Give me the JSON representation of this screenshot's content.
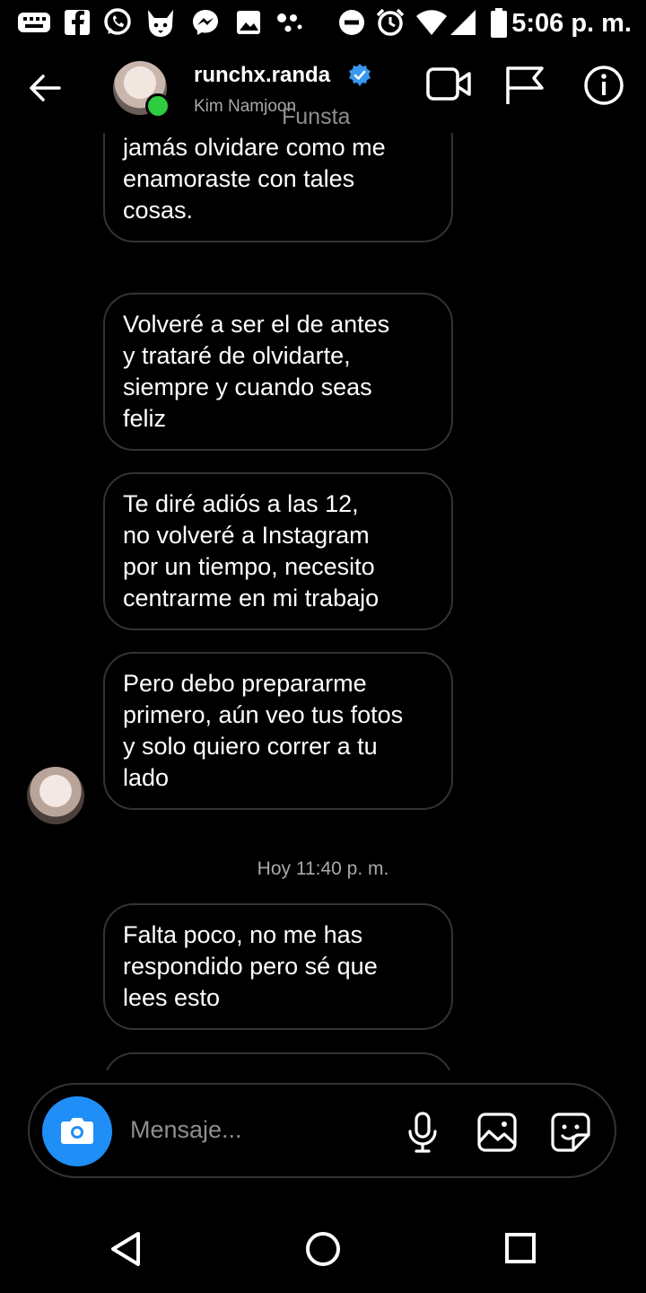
{
  "status_bar": {
    "time": "5:06 p. m.",
    "icons": [
      "keyboard-icon",
      "facebook-icon",
      "whatsapp-icon",
      "fox-icon",
      "messenger-icon",
      "gallery-icon",
      "dots-icon",
      "dnd-icon",
      "alarm-icon",
      "wifi-icon",
      "signal-icon",
      "battery-icon"
    ]
  },
  "header": {
    "username": "runchx.randa",
    "subtitle": "Kim Namjoon",
    "overlay_text": "Funsta",
    "icons": [
      "back-arrow-icon",
      "verified-badge-icon",
      "video-call-icon",
      "flag-icon",
      "info-icon"
    ]
  },
  "messages": [
    {
      "text": "con pequeñas cosas y\njamás olvidare como me\nenamoraste con tales\ncosas."
    },
    {
      "text": "Volveré a ser el de antes\ny trataré de olvidarte,\nsiempre y cuando seas\nfeliz"
    },
    {
      "text": "Te diré adiós a las 12,\nno volveré a Instagram\npor un tiempo, necesito\ncentrarme en mi trabajo"
    },
    {
      "text": "Pero debo prepararme\nprimero, aún veo tus fotos\ny solo quiero correr a tu\nlado"
    },
    {
      "text": "Falta poco, no me has\nrespondido pero sé que\nlees esto"
    }
  ],
  "timestamp": "Hoy 11:40 p. m.",
  "composer": {
    "placeholder": "Mensaje...",
    "icons": [
      "camera-icon",
      "microphone-icon",
      "image-icon",
      "sticker-icon"
    ]
  },
  "nav": {
    "icons": [
      "back-triangle-icon",
      "home-circle-icon",
      "recents-square-icon"
    ]
  },
  "colors": {
    "background": "#000000",
    "accent": "#1f8ef7",
    "online": "#2ecc40",
    "bubble_border": "#333333",
    "muted_text": "#a8a8a8"
  }
}
